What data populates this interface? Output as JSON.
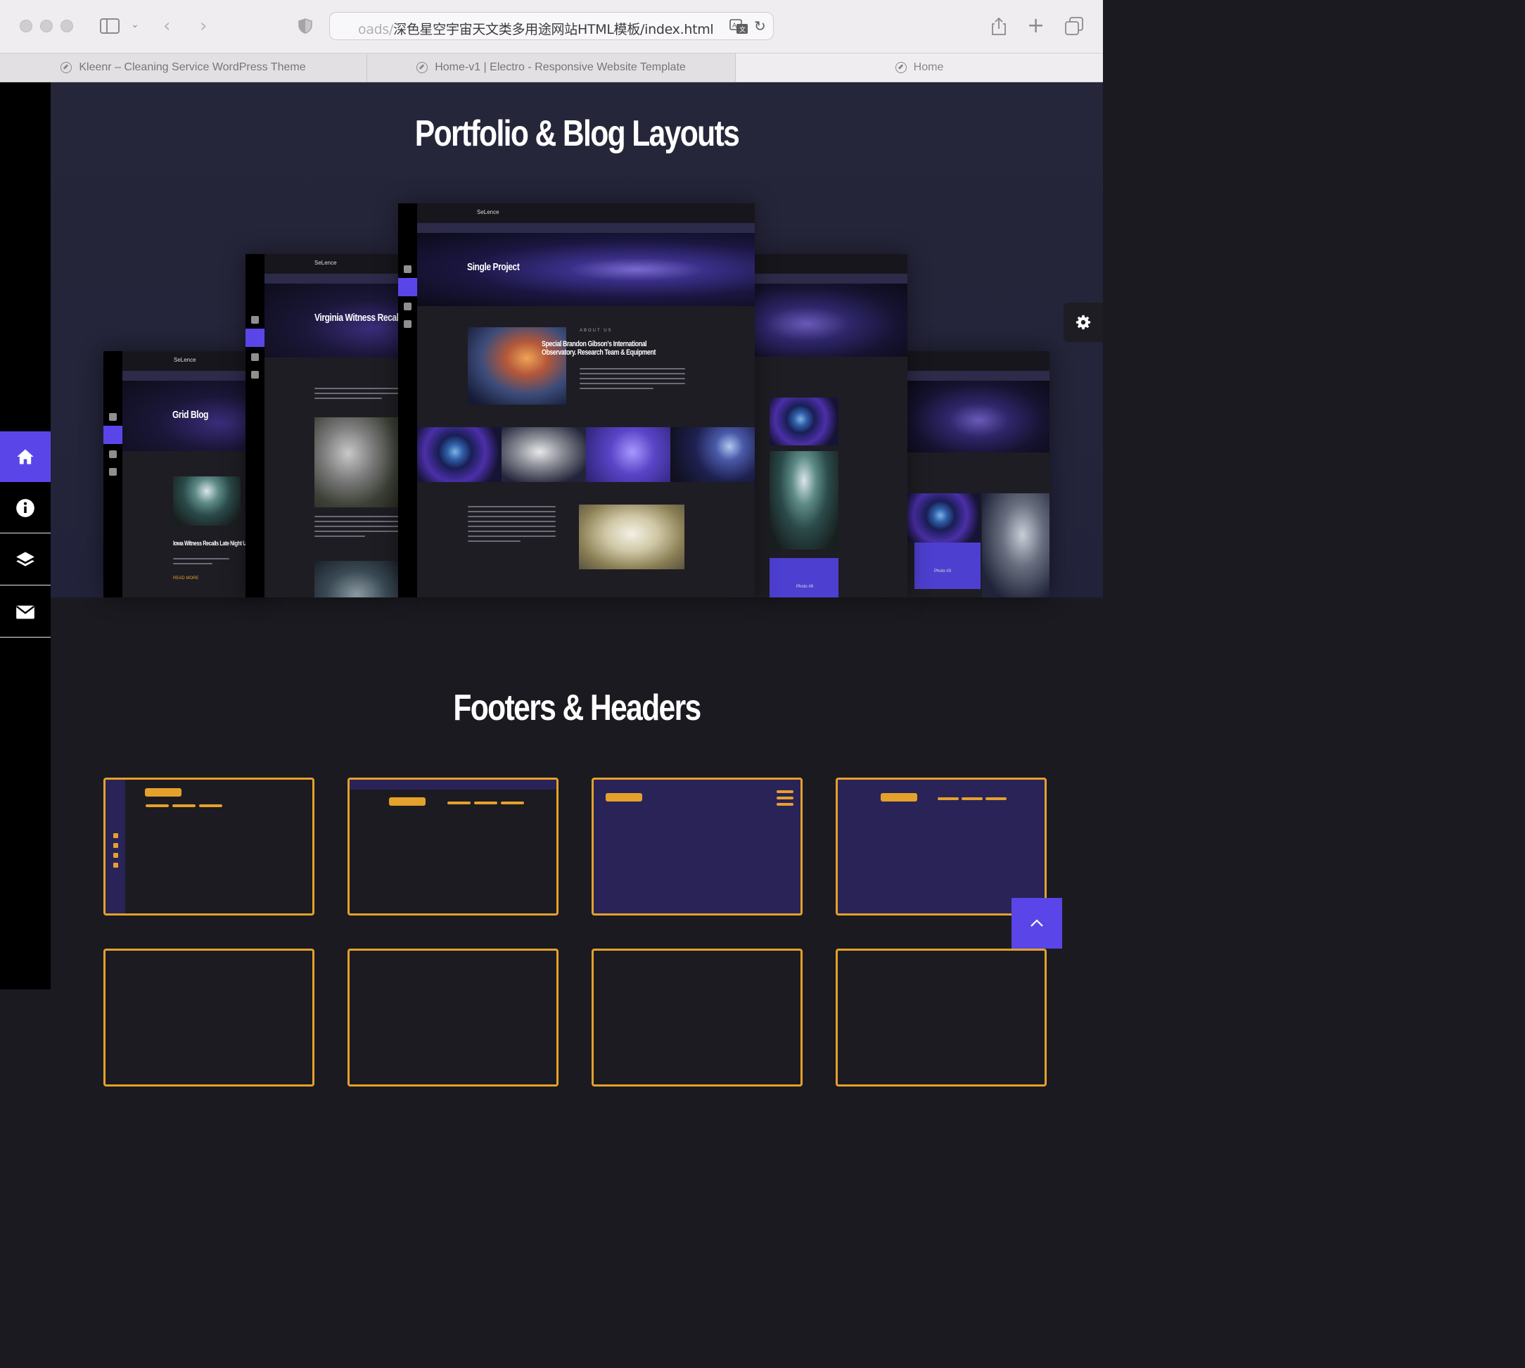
{
  "browser": {
    "url_prefix": "oads/",
    "url_main": "深色星空宇宙天文类多用途网站HTML模板/index.html",
    "tabs": [
      {
        "title": "Kleenr – Cleaning Service WordPress Theme",
        "active": false
      },
      {
        "title": "Home-v1 | Electro - Responsive Website Template",
        "active": false
      },
      {
        "title": "Home",
        "active": true
      }
    ]
  },
  "sidebar": {
    "items": [
      {
        "icon": "home-icon",
        "active": true
      },
      {
        "icon": "info-icon",
        "active": false
      },
      {
        "icon": "layers-icon",
        "active": false
      },
      {
        "icon": "mail-icon",
        "active": false
      }
    ]
  },
  "sections": {
    "portfolio_title": "Portfolio & Blog Layouts",
    "footers_title": "Footers & Headers"
  },
  "mockups": {
    "grid_blog": {
      "brand": "SeLence",
      "title": "Grid Blog",
      "post": "Iowa Witness Recalls Late Night UFO Close Encounter",
      "read_more": "READ MORE"
    },
    "blog_single": {
      "brand": "SeLence",
      "title": "Virginia Witness Recal"
    },
    "single_project": {
      "brand": "SeLence",
      "title": "Single Project",
      "about_label": "ABOUT US",
      "headline": "Special Brandon Gibson's International Observatory. Research Team & Equipment"
    },
    "gallery": {
      "card_label": "Photo #9"
    },
    "gallery_wide": {
      "card_label": "Photo #3"
    }
  },
  "colors": {
    "accent": "#5a46e8",
    "orange": "#e4a12b",
    "background": "#1b1a20",
    "hero": "#25253a"
  }
}
